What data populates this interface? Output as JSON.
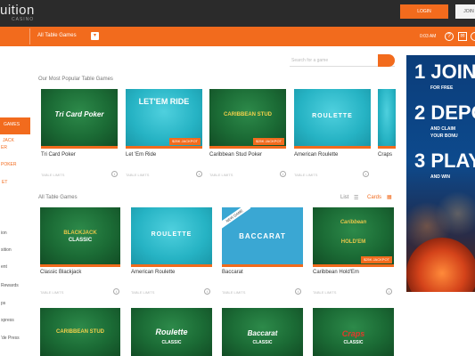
{
  "header": {
    "logo": "uition",
    "logo_sub": "CASINO",
    "login": "LOGIN",
    "join": "JOIN"
  },
  "nav": {
    "title": "All Table Games",
    "time": "0:03 AM",
    "icons": [
      "help-icon",
      "mail-icon",
      "account-icon"
    ]
  },
  "sidebar": {
    "items": [
      {
        "label": "GAMES",
        "style": "white"
      },
      {
        "label": "JACK",
        "style": "orange"
      },
      {
        "label": "ER",
        "style": "orange"
      },
      {
        "label": "POKER",
        "style": "orange"
      },
      {
        "label": "ET",
        "style": "orange"
      },
      {
        "label": "ion",
        "style": "plain"
      },
      {
        "label": "sition",
        "style": "plain"
      },
      {
        "label": "ent",
        "style": "plain"
      },
      {
        "label": "Rewards",
        "style": "plain"
      },
      {
        "label": "ps",
        "style": "plain"
      },
      {
        "label": "xpress",
        "style": "plain"
      },
      {
        "label": "'de Press",
        "style": "plain"
      }
    ]
  },
  "search": {
    "placeholder": "Search for a game"
  },
  "popular": {
    "title": "Our Most Popular Table Games",
    "limit_text": "TABLE LIMITS",
    "tiles": [
      {
        "name": "Tri Card Poker",
        "art": "Tri Card Poker",
        "theme": "green",
        "jackpot": ""
      },
      {
        "name": "Let 'Em Ride",
        "art": "LET'EM RIDE",
        "theme": "cyan",
        "jackpot": "$25K JACKPOT"
      },
      {
        "name": "Caribbean Stud Poker",
        "art": "CARIBBEAN STUD",
        "theme": "green",
        "jackpot": "$25K JACKPOT"
      },
      {
        "name": "American Roulette",
        "art": "ROULETTE",
        "theme": "cyan",
        "jackpot": ""
      },
      {
        "name": "Craps",
        "art": "",
        "theme": "cyan",
        "jackpot": ""
      }
    ]
  },
  "all": {
    "title": "All Table Games",
    "list_label": "List",
    "cards_label": "Cards",
    "limit_text": "TABLE LIMITS",
    "tiles": [
      {
        "name": "Classic Blackjack",
        "art": "CLASSIC",
        "art_top": "BLACKJACK",
        "theme": "green",
        "jackpot": "",
        "new": false
      },
      {
        "name": "American Roulette",
        "art": "ROULETTE",
        "art_top": "",
        "theme": "cyan",
        "jackpot": "",
        "new": false
      },
      {
        "name": "Baccarat",
        "art": "BACCARAT",
        "art_top": "",
        "theme": "blue",
        "jackpot": "",
        "new": true
      },
      {
        "name": "Caribbean Hold'Em",
        "art": "HOLD'EM",
        "art_top": "Caribbean",
        "theme": "green",
        "jackpot": "$25K JACKPOT",
        "new": false
      }
    ],
    "row3": [
      {
        "art": "CARIBBEAN STUD"
      },
      {
        "art": "Roulette",
        "art_sub": "CLASSIC"
      },
      {
        "art": "Baccarat",
        "art_sub": "CLASSIC"
      },
      {
        "art": "Craps",
        "art_sub": "CLASSIC"
      }
    ],
    "new_badge": "NEW GAME"
  },
  "ad": {
    "steps": [
      {
        "big": "1 JOIN",
        "sub1": "FOR FREE",
        "sub2": ""
      },
      {
        "big": "2 DEPOS",
        "sub1": "AND CLAIM",
        "sub2": "YOUR BONU"
      },
      {
        "big": "3 PLAY",
        "sub1": "AND WIN",
        "sub2": ""
      }
    ]
  },
  "colors": {
    "accent": "#f26b1d",
    "topbar": "#2b2b2b"
  }
}
